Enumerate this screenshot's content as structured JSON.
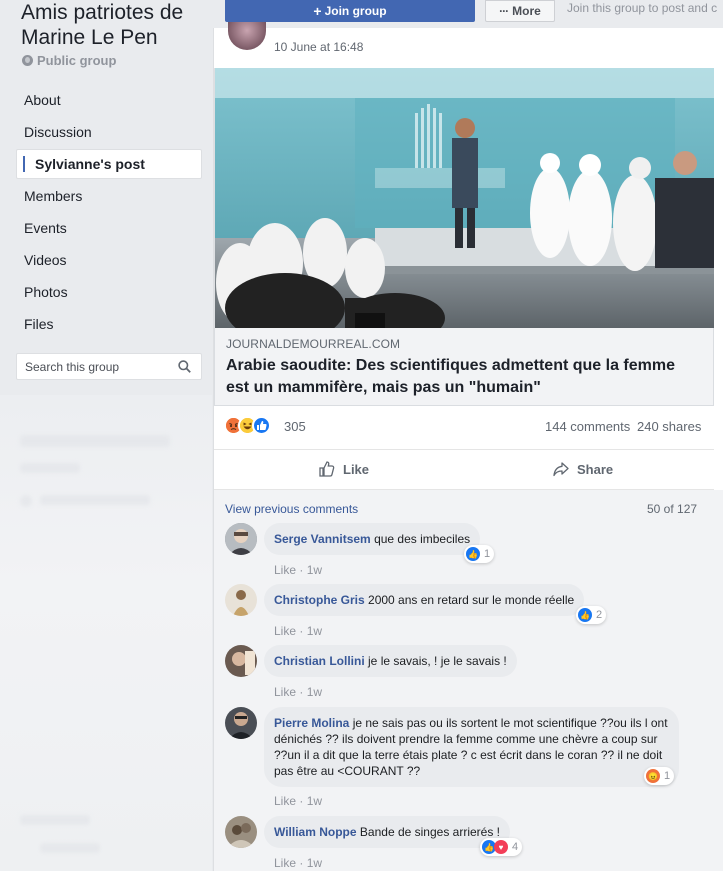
{
  "group": {
    "name": "Amis patriotes de Marine Le Pen",
    "type": "Public group"
  },
  "nav": {
    "items": [
      {
        "label": "About"
      },
      {
        "label": "Discussion"
      },
      {
        "label": "Sylvianne's post",
        "active": true
      },
      {
        "label": "Members"
      },
      {
        "label": "Events"
      },
      {
        "label": "Videos"
      },
      {
        "label": "Photos"
      },
      {
        "label": "Files"
      }
    ]
  },
  "search": {
    "placeholder": "Search this group"
  },
  "topbar": {
    "join_label": "Join group",
    "join_icon": "plus-icon",
    "more_label": "More",
    "hint": "Join this group to post and c"
  },
  "post": {
    "time": "10 June at 16:48",
    "link": {
      "domain": "JOURNALDEMOURREAL.COM",
      "title": "Arabie saoudite: Des scientifiques admettent que la femme est un mammifère, mais pas un \"humain\""
    },
    "reactions": {
      "icons": [
        "angry-icon",
        "haha-icon",
        "like-icon"
      ],
      "count": "305",
      "comments": "144 comments",
      "shares": "240 shares"
    },
    "actions": {
      "like": "Like",
      "share": "Share"
    }
  },
  "comments": {
    "view_previous": "View previous comments",
    "page_count": "50 of 127",
    "items": [
      {
        "name": "Serge Vannitsem",
        "text": "que des imbeciles",
        "like": "Like",
        "time": "1w",
        "reaction_icons": [
          "like-icon"
        ],
        "reaction_count": "1"
      },
      {
        "name": "Christophe Gris",
        "text": "2000 ans en retard sur le monde réelle",
        "like": "Like",
        "time": "1w",
        "reaction_icons": [
          "like-icon"
        ],
        "reaction_count": "2"
      },
      {
        "name": "Christian Lollini",
        "text": "je le savais, ! je le savais !",
        "like": "Like",
        "time": "1w",
        "reaction_icons": [],
        "reaction_count": ""
      },
      {
        "name": "Pierre Molina",
        "text": "je ne sais pas ou ils sortent le mot scientifique ??ou ils l ont dénichés ?? ils doivent prendre la femme comme une chèvre a coup sur ??un il a dit que la terre étais plate ? c est écrit dans le coran ?? il ne doit pas être au <COURANT ??",
        "like": "Like",
        "time": "1w",
        "reaction_icons": [
          "angry-icon"
        ],
        "reaction_count": "1"
      },
      {
        "name": "William Noppe",
        "text": "Bande de singes arrierés !",
        "like": "Like",
        "time": "1w",
        "reaction_icons": [
          "like-icon",
          "love-icon"
        ],
        "reaction_count": "4"
      }
    ]
  },
  "colors": {
    "brand": "#4267b2",
    "link": "#385898",
    "page_bg": "#e9ebee"
  }
}
